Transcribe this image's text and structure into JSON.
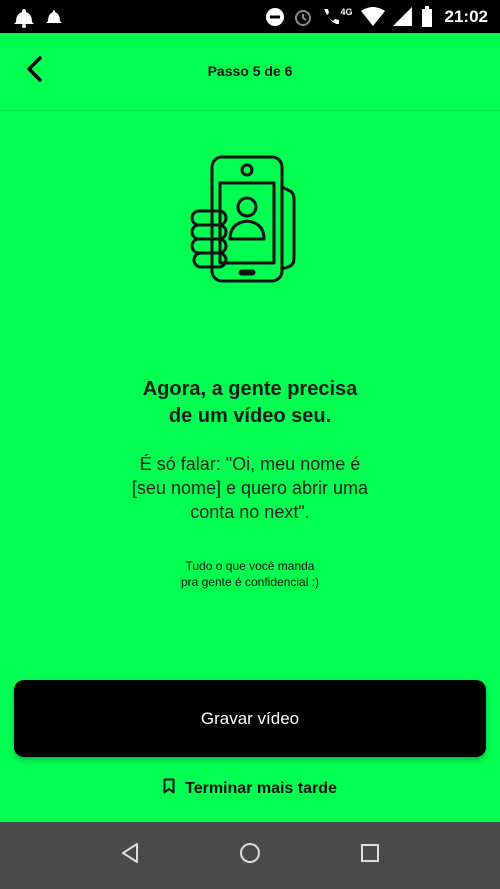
{
  "status_bar": {
    "time": "21:02",
    "network_label": "4G",
    "icons": [
      "notification-bell-icon",
      "dnd-icon",
      "alarm-icon",
      "wifi-calling-icon",
      "wifi-icon",
      "signal-icon",
      "battery-icon"
    ]
  },
  "header": {
    "step": "Passo 5 de 6",
    "back_icon": "chevron-left-icon"
  },
  "illustration": {
    "icon": "selfie-phone-icon"
  },
  "content": {
    "headline_line1": "Agora, a gente precisa",
    "headline_line2": "de um vídeo seu.",
    "body_line1": "É só falar: \"Oi, meu nome é",
    "body_line2": "[seu nome] e quero abrir uma",
    "body_line3": "conta no next\".",
    "note_line1": "Tudo o que você manda",
    "note_line2": "pra gente é confidencial :)"
  },
  "actions": {
    "record_label": "Gravar vídeo",
    "later_label": "Terminar mais tarde",
    "later_icon": "bookmark-icon"
  },
  "colors": {
    "background": "#00ff50",
    "button": "#000000",
    "nav_bar": "#4a4a4a"
  }
}
